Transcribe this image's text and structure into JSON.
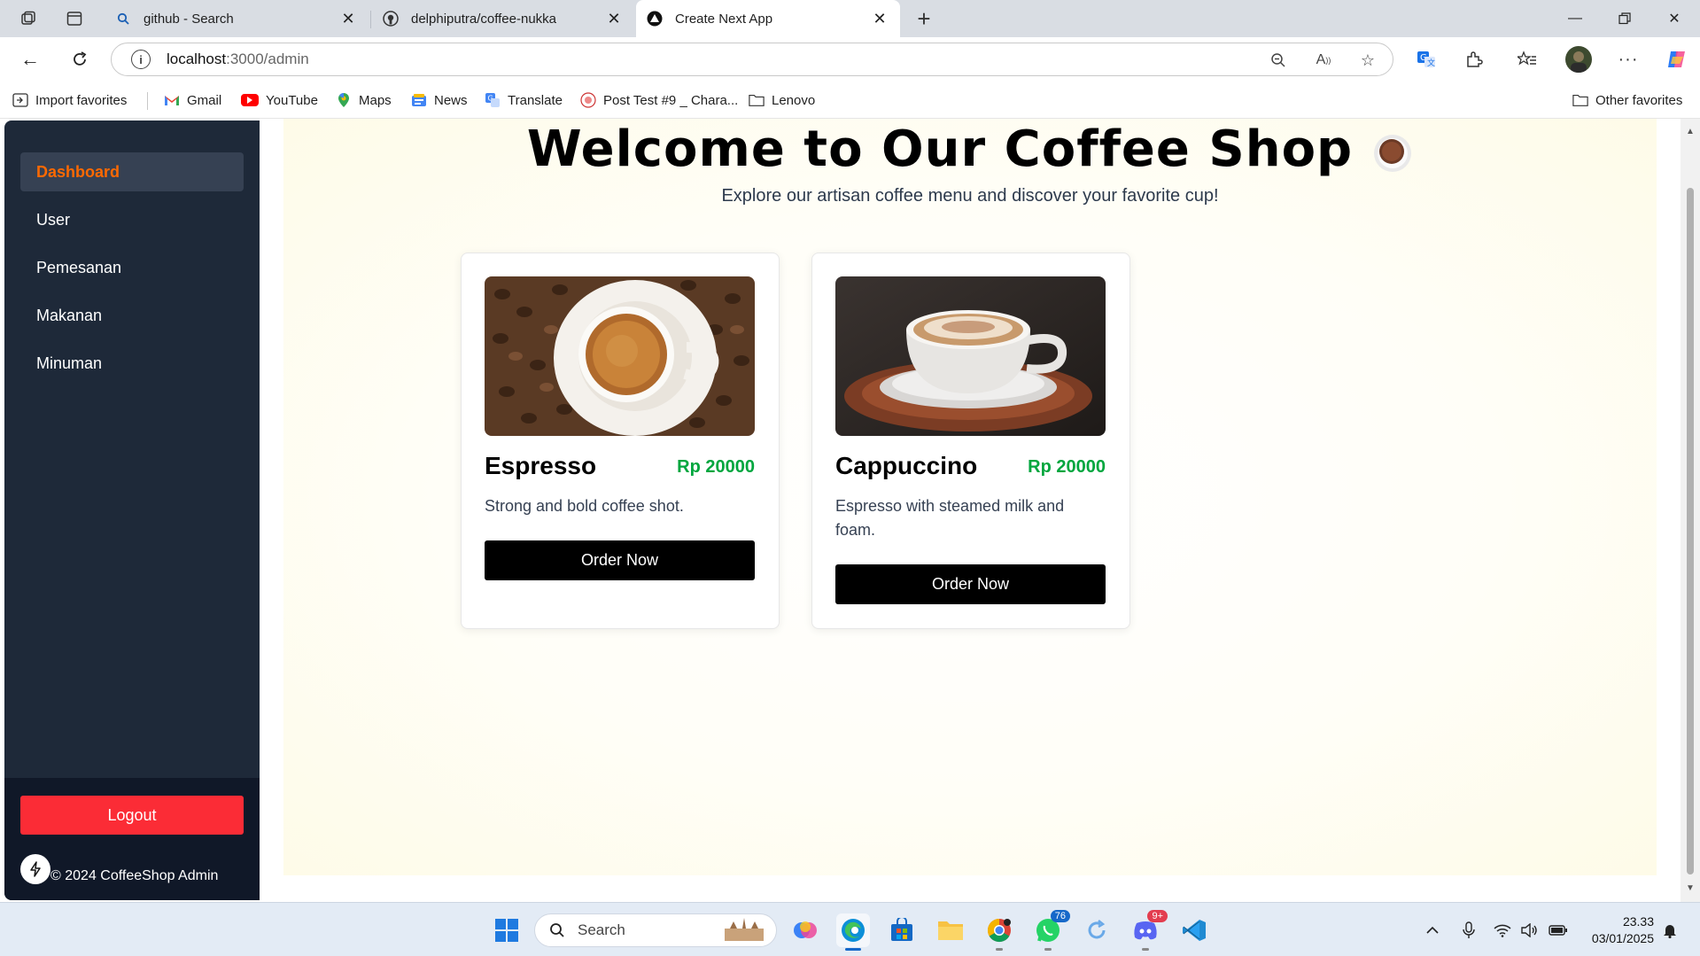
{
  "browser": {
    "tabs": [
      {
        "title": "github - Search",
        "icon": "search-icon",
        "active": false
      },
      {
        "title": "delphiputra/coffee-nukka",
        "icon": "github-icon",
        "active": false
      },
      {
        "title": "Create Next App",
        "icon": "nextjs-icon",
        "active": true
      }
    ],
    "new_tab_label": "+",
    "address": {
      "host": "localhost",
      "path": ":3000/admin"
    },
    "favorites": [
      {
        "label": "Import favorites",
        "icon": "import-icon"
      },
      {
        "label": "Gmail",
        "icon": "gmail-icon"
      },
      {
        "label": "YouTube",
        "icon": "youtube-icon"
      },
      {
        "label": "Maps",
        "icon": "maps-icon"
      },
      {
        "label": "News",
        "icon": "news-icon"
      },
      {
        "label": "Translate",
        "icon": "translate-icon"
      },
      {
        "label": "Post Test #9 _ Chara...",
        "icon": "site-icon"
      },
      {
        "label": "Lenovo",
        "icon": "folder-icon"
      }
    ],
    "other_favorites": "Other favorites"
  },
  "sidebar": {
    "items": [
      {
        "label": "Dashboard",
        "active": true
      },
      {
        "label": "User",
        "active": false
      },
      {
        "label": "Pemesanan",
        "active": false
      },
      {
        "label": "Makanan",
        "active": false
      },
      {
        "label": "Minuman",
        "active": false
      }
    ],
    "logout_label": "Logout",
    "copyright": "© 2024 CoffeeShop Admin"
  },
  "hero": {
    "title": "Welcome to Our Coffee Shop",
    "subtitle": "Explore our artisan coffee menu and discover your favorite cup!"
  },
  "products": [
    {
      "name": "Espresso",
      "price": "Rp 20000",
      "description": "Strong and bold coffee shot.",
      "button": "Order Now"
    },
    {
      "name": "Cappuccino",
      "price": "Rp 20000",
      "description": "Espresso with steamed milk and foam.",
      "button": "Order Now"
    }
  ],
  "taskbar": {
    "search_placeholder": "Search",
    "whatsapp_badge": "76",
    "discord_badge": "9+",
    "time": "23.33",
    "date": "03/01/2025"
  },
  "colors": {
    "sidebar_bg": "#1e2939",
    "sidebar_active_text": "#ff6900",
    "logout_bg": "#fb2c36",
    "price_green": "#00a63e",
    "content_bg": "#fefbe8"
  }
}
